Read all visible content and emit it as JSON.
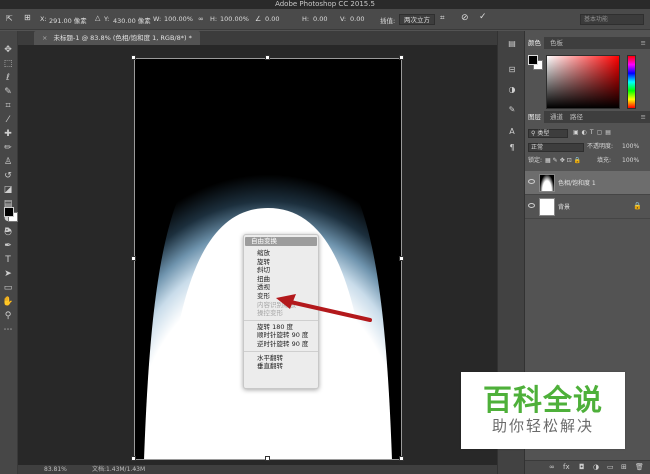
{
  "app": {
    "title": "Adobe Photoshop CC 2015.5"
  },
  "options_bar": {
    "x_label": "X:",
    "x_value": "291.00 像素",
    "y_label": "Y:",
    "y_value": "430.00 像素",
    "w_label": "W:",
    "w_value": "100.00%",
    "h_label": "H:",
    "h_value": "100.00%",
    "angle_value": "0.00",
    "hskew_label": "H:",
    "hskew_value": "0.00",
    "vskew_label": "V:",
    "vskew_value": "0.00",
    "interp_label": "插值:",
    "interp_value": "两次立方",
    "search_placeholder": "基本功能"
  },
  "document": {
    "tab_title": "未标题-1 @ 83.8% (色相/饱和度 1, RGB/8*) *",
    "close": "×",
    "zoom": "83.81%",
    "doc_info": "文档:1.43M/1.43M"
  },
  "context_menu": {
    "header": "自由变换",
    "groups": [
      [
        {
          "label": "缩放",
          "enabled": true
        },
        {
          "label": "旋转",
          "enabled": true
        },
        {
          "label": "斜切",
          "enabled": true
        },
        {
          "label": "扭曲",
          "enabled": true
        },
        {
          "label": "透视",
          "enabled": true
        },
        {
          "label": "变形",
          "enabled": true
        },
        {
          "label": "内容识别缩放",
          "enabled": false
        },
        {
          "label": "操控变形",
          "enabled": false
        }
      ],
      [
        {
          "label": "旋转 180 度",
          "enabled": true
        },
        {
          "label": "顺时针旋转 90 度",
          "enabled": true
        },
        {
          "label": "逆时针旋转 90 度",
          "enabled": true
        }
      ],
      [
        {
          "label": "水平翻转",
          "enabled": true
        },
        {
          "label": "垂直翻转",
          "enabled": true
        }
      ]
    ]
  },
  "color_panel": {
    "tabs": [
      "颜色",
      "色板"
    ],
    "foreground": "#000000",
    "background": "#ffffff"
  },
  "layers_panel": {
    "tabs": [
      "图层",
      "通道",
      "路径"
    ],
    "kind_label": "类型",
    "blend_mode": "正常",
    "opacity_label": "不透明度:",
    "opacity_value": "100%",
    "lock_label": "锁定:",
    "fill_label": "填充:",
    "fill_value": "100%",
    "layers": [
      {
        "name": "色相/饱和度 1",
        "selected": true,
        "thumb": "adj"
      },
      {
        "name": "背景",
        "selected": false,
        "thumb": "white",
        "locked": true
      }
    ]
  },
  "watermark": {
    "title": "百科全说",
    "subtitle": "助你轻松解决"
  },
  "colors": {
    "arrow": "#b3191c",
    "watermark_green": "#4eb03a"
  }
}
